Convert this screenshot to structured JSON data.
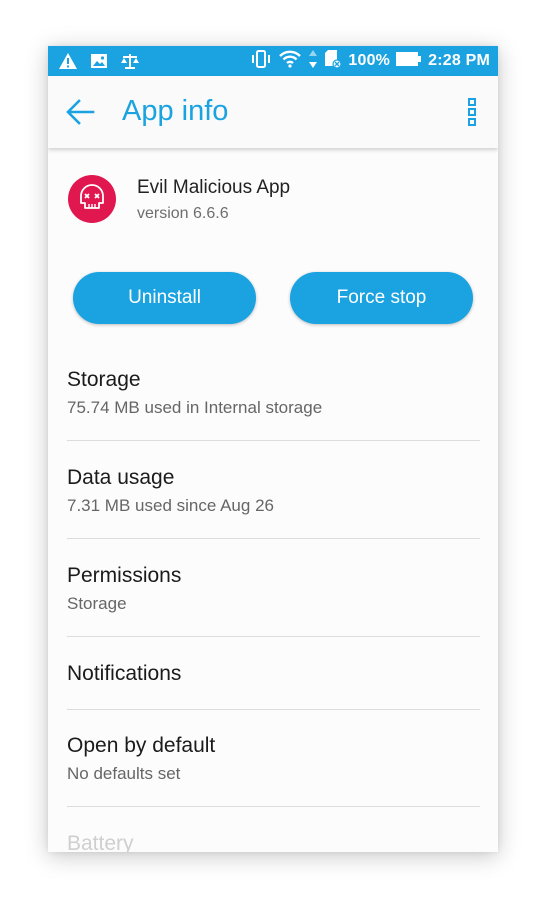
{
  "status_bar": {
    "battery_percent": "100%",
    "time": "2:28 PM",
    "left_icons": [
      "warning-icon",
      "image-icon",
      "scale-icon"
    ],
    "right_icons": [
      "vibrate-icon",
      "wifi-icon",
      "data-arrows-icon",
      "sd-card-icon",
      "battery-icon"
    ]
  },
  "toolbar": {
    "title": "App info",
    "back_icon": "arrow-left-icon",
    "menu_icon": "more-vert-icon"
  },
  "app": {
    "name": "Evil Malicious App",
    "version": "version 6.6.6",
    "icon": "skull-icon",
    "icon_color": "#e0184f"
  },
  "actions": {
    "uninstall": "Uninstall",
    "force_stop": "Force stop"
  },
  "items": [
    {
      "title": "Storage",
      "subtitle": "75.74 MB used in Internal storage"
    },
    {
      "title": "Data usage",
      "subtitle": "7.31 MB used since Aug 26"
    },
    {
      "title": "Permissions",
      "subtitle": "Storage"
    },
    {
      "title": "Notifications"
    },
    {
      "title": "Open by default",
      "subtitle": "No defaults set"
    },
    {
      "title": "Battery"
    }
  ],
  "colors": {
    "accent": "#1aa3e0",
    "danger": "#e0184f"
  }
}
